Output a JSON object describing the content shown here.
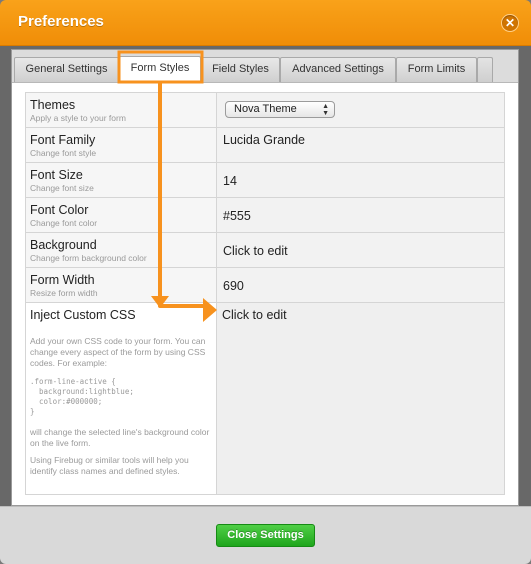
{
  "dialog": {
    "title": "Preferences",
    "close_icon": "close-icon"
  },
  "tabs": [
    {
      "label": "General Settings"
    },
    {
      "label": "Form Styles",
      "active": true
    },
    {
      "label": "Field Styles"
    },
    {
      "label": "Advanced Settings"
    },
    {
      "label": "Form Limits"
    }
  ],
  "rows": [
    {
      "title": "Themes",
      "subtitle": "Apply a style to your form",
      "value": "Nova Theme",
      "control": "select"
    },
    {
      "title": "Font Family",
      "subtitle": "Change font style",
      "value": "Lucida Grande"
    },
    {
      "title": "Font Size",
      "subtitle": "Change font size",
      "value": "14"
    },
    {
      "title": "Font Color",
      "subtitle": "Change font color",
      "value": "#555"
    },
    {
      "title": "Background",
      "subtitle": "Change form background color",
      "value": "Click to edit"
    },
    {
      "title": "Form Width",
      "subtitle": "Resize form width",
      "value": "690"
    },
    {
      "title": "Inject Custom CSS",
      "value": "Click to edit"
    }
  ],
  "custom_css": {
    "help": "Add your own CSS code to your form. You can change every aspect of the form by using CSS codes. For example:",
    "code": ".form-line-active {\n  background:lightblue;\n  color:#000000;\n}",
    "after": "will change the selected line's background color on the live form.",
    "firebug": "Using Firebug or similar tools will help you identify class names and defined styles."
  },
  "footer": {
    "close_button": "Close Settings"
  },
  "colors": {
    "titlebar": "#f39611",
    "highlight": "#f7921e",
    "close_button": "#2db52a"
  }
}
